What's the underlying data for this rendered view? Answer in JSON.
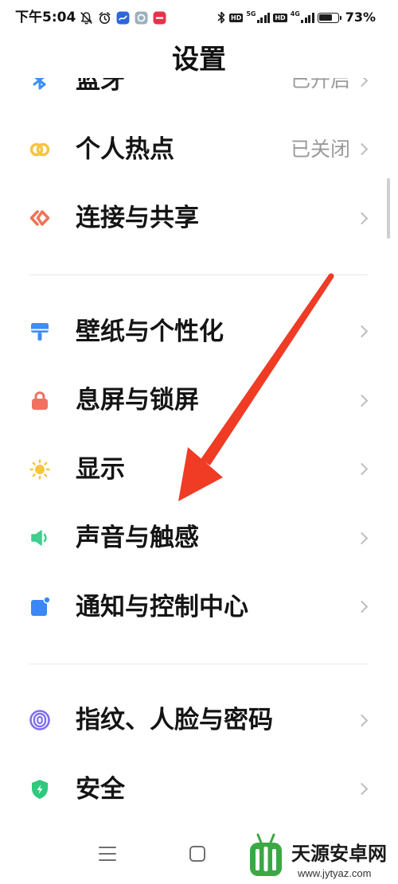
{
  "status_bar": {
    "time": "下午5:04",
    "left_icons": [
      "bell-off-icon",
      "alarm-icon",
      "app-icon-blue",
      "app-icon-gray",
      "app-icon-red"
    ],
    "bluetooth_icon": "bluetooth-icon",
    "sim1": {
      "hd": "HD",
      "network": "5G",
      "signal_bars": 4
    },
    "sim2": {
      "hd": "HD",
      "network": "4G",
      "signal_bars": 4
    },
    "battery_percent": "73%",
    "battery_level": 0.73
  },
  "header": {
    "title": "设置"
  },
  "settings": {
    "items": [
      {
        "label": "蓝牙",
        "status": "已开启",
        "icon": "bluetooth-icon",
        "color": "#3b8ff6"
      },
      {
        "label": "个人热点",
        "status": "已关闭",
        "icon": "hotspot-icon",
        "color": "#f5c542"
      },
      {
        "label": "连接与共享",
        "icon": "connection-sharing-icon",
        "color": "#f07354"
      },
      {
        "label": "壁纸与个性化",
        "icon": "wallpaper-icon",
        "color": "#3d8ef5"
      },
      {
        "label": "息屏与锁屏",
        "icon": "lock-icon",
        "color": "#f2705f"
      },
      {
        "label": "显示",
        "icon": "sun-icon",
        "color": "#f8c63e"
      },
      {
        "label": "声音与触感",
        "icon": "speaker-icon",
        "color": "#3fcf8e"
      },
      {
        "label": "通知与控制中心",
        "icon": "notification-icon",
        "color": "#3a87f5"
      },
      {
        "label": "指纹、人脸与密码",
        "icon": "fingerprint-icon",
        "color": "#7d6ef0"
      },
      {
        "label": "安全",
        "icon": "shield-icon",
        "color": "#2dc97d"
      }
    ]
  },
  "nav_bar": {
    "icons": [
      "menu-icon",
      "home-icon"
    ]
  },
  "watermark": {
    "name": "天源安卓网",
    "url": "www.jytyaz.com"
  },
  "colors": {
    "arrow": "#f03b25",
    "logo_green": "#3aa845"
  }
}
